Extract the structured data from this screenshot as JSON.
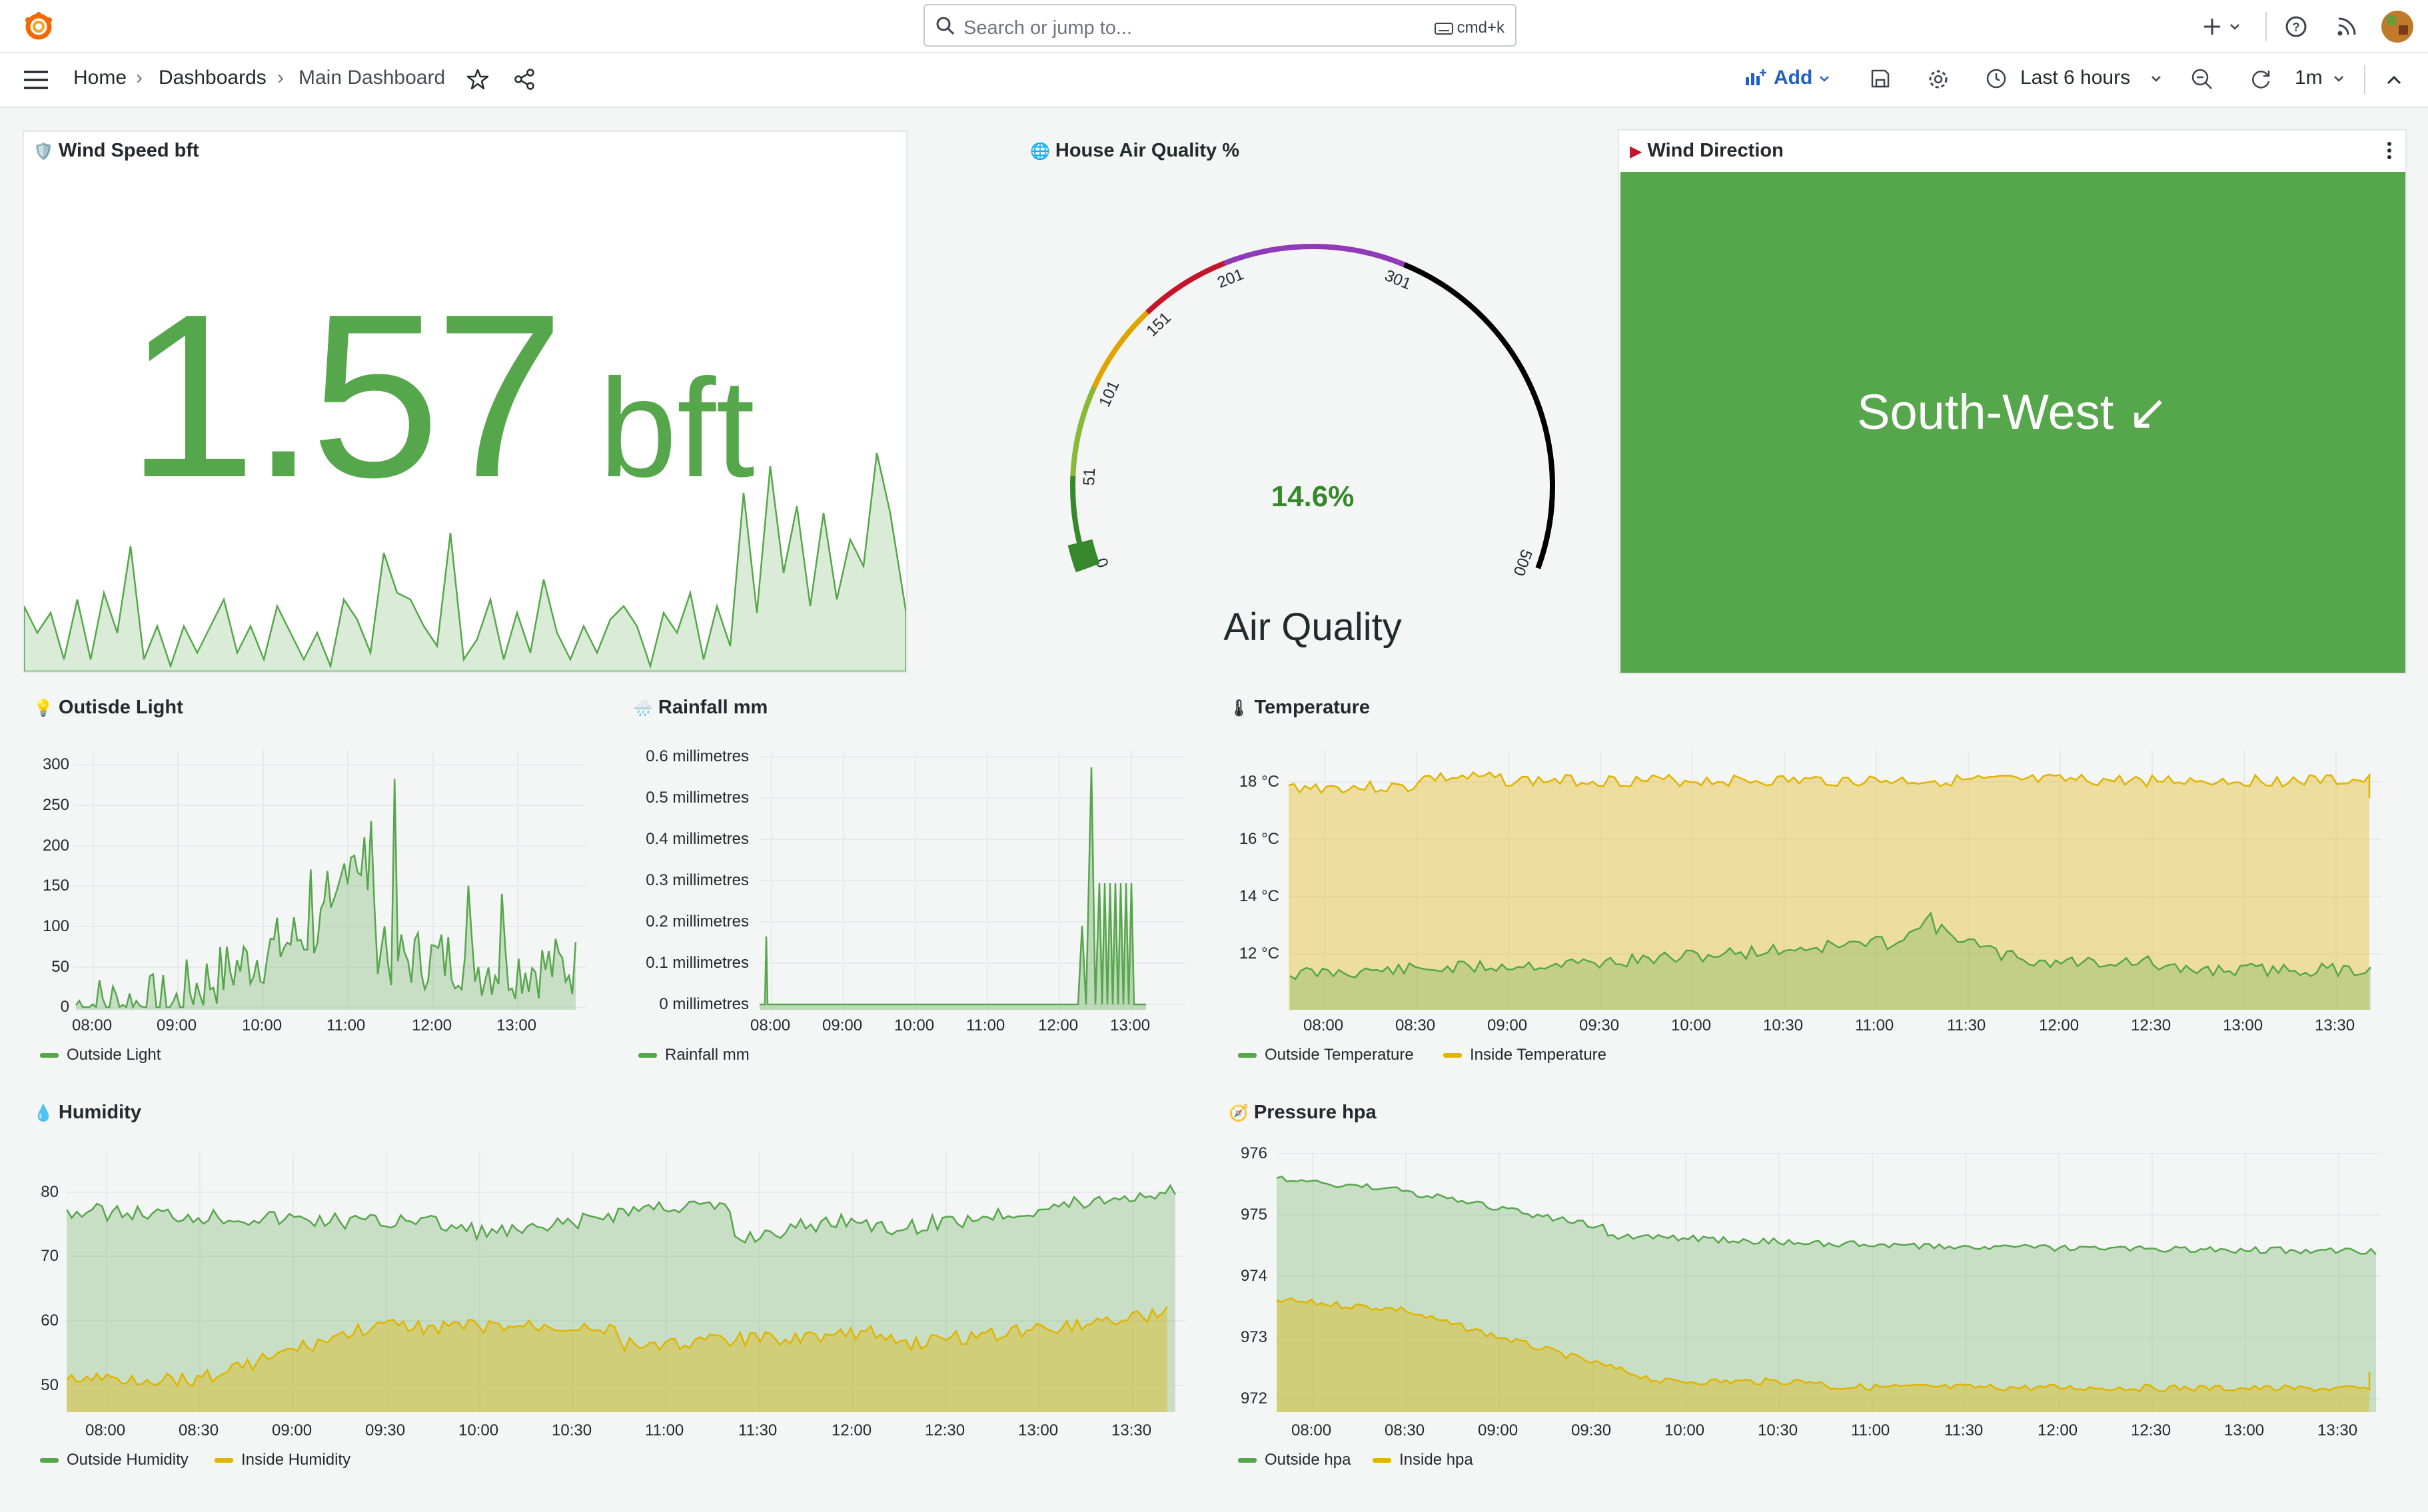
{
  "colors": {
    "green": "#56a64b",
    "green_fill": "#56a64b",
    "yellow": "#e0b400",
    "text": "#24292e",
    "accent": "#1f60c4"
  },
  "topbar": {
    "search_placeholder": "Search or jump to...",
    "search_shortcut": "cmd+k",
    "icons": [
      "grafana-logo-icon",
      "search-icon",
      "keyboard-icon",
      "plus-icon",
      "chevron-down-icon",
      "help-icon",
      "rss-icon",
      "avatar"
    ]
  },
  "navbar": {
    "breadcrumb": [
      "Home",
      "Dashboards",
      "Main Dashboard"
    ],
    "add_label": "Add",
    "time_range": "Last 6 hours",
    "refresh_interval": "1m"
  },
  "panels": {
    "wind_speed": {
      "title": "Wind Speed bft",
      "value": "1.57",
      "unit": "bft"
    },
    "air_quality": {
      "title": "House Air Quality %",
      "value": "14.6%",
      "label": "Air Quality",
      "thresholds": [
        "0",
        "51",
        "101",
        "151",
        "201",
        "301",
        "500"
      ]
    },
    "wind_direction": {
      "title": "Wind Direction",
      "value": "South-West ↙"
    },
    "outside_light": {
      "title": "Outisde Light",
      "yticks": [
        "300",
        "250",
        "200",
        "150",
        "100",
        "50",
        "0"
      ],
      "xticks": [
        "08:00",
        "09:00",
        "10:00",
        "11:00",
        "12:00",
        "13:00"
      ],
      "legend": [
        "Outside Light"
      ]
    },
    "rainfall": {
      "title": "Rainfall mm",
      "yticks": [
        "0.6 millimetres",
        "0.5 millimetres",
        "0.4 millimetres",
        "0.3 millimetres",
        "0.2 millimetres",
        "0.1 millimetres",
        "0 millimetres"
      ],
      "xticks": [
        "08:00",
        "09:00",
        "10:00",
        "11:00",
        "12:00",
        "13:00"
      ],
      "legend": [
        "Rainfall mm"
      ]
    },
    "temperature": {
      "title": "Temperature",
      "yticks": [
        "18 °C",
        "16 °C",
        "14 °C",
        "12 °C"
      ],
      "xticks": [
        "08:00",
        "08:30",
        "09:00",
        "09:30",
        "10:00",
        "10:30",
        "11:00",
        "11:30",
        "12:00",
        "12:30",
        "13:00",
        "13:30"
      ],
      "legend": [
        "Outside Temperature",
        "Inside Temperature"
      ]
    },
    "humidity": {
      "title": "Humidity",
      "yticks": [
        "80",
        "70",
        "60",
        "50"
      ],
      "xticks": [
        "08:00",
        "08:30",
        "09:00",
        "09:30",
        "10:00",
        "10:30",
        "11:00",
        "11:30",
        "12:00",
        "12:30",
        "13:00",
        "13:30"
      ],
      "legend": [
        "Outside Humidity",
        "Inside Humidity"
      ]
    },
    "pressure": {
      "title": "Pressure hpa",
      "yticks": [
        "976",
        "975",
        "974",
        "973",
        "972"
      ],
      "xticks": [
        "08:00",
        "08:30",
        "09:00",
        "09:30",
        "10:00",
        "10:30",
        "11:00",
        "11:30",
        "12:00",
        "12:30",
        "13:00",
        "13:30"
      ],
      "legend": [
        "Outside hpa",
        "Inside hpa"
      ]
    }
  }
}
